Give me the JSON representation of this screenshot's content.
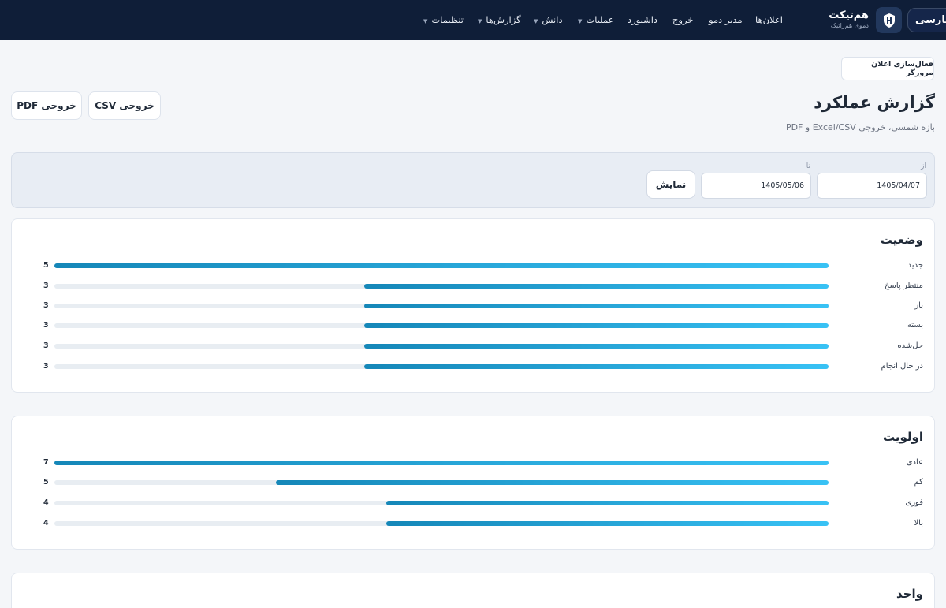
{
  "nav": {
    "lang": "فارسی",
    "brand_name": "هم‌تیکت",
    "brand_sub": "دموی هم‌راتیک",
    "items": [
      "اعلان‌ها",
      "مدیر دمو",
      "خروج",
      "داشبورد",
      "عملیات",
      "دانش",
      "گزارش‌ها",
      "تنظیمات"
    ]
  },
  "header": {
    "notify_button": "فعال‌سازی اعلان مرورگر",
    "title": "گزارش عملکرد",
    "subtitle": "بازه شمسی، خروجی Excel/CSV و PDF",
    "export_csv": "خروجی CSV",
    "export_pdf": "خروجی PDF"
  },
  "filter": {
    "from_label": "از",
    "to_label": "تا",
    "from_value": "1405/04/07",
    "to_value": "1405/05/06",
    "show_button": "نمایش"
  },
  "cards": [
    {
      "title": "وضعیت",
      "max": 5,
      "rows": [
        {
          "label": "جدید",
          "value": "5"
        },
        {
          "label": "منتظر پاسخ",
          "value": "3"
        },
        {
          "label": "باز",
          "value": "3"
        },
        {
          "label": "بسته",
          "value": "3"
        },
        {
          "label": "حل‌شده",
          "value": "3"
        },
        {
          "label": "در حال انجام",
          "value": "3"
        }
      ]
    },
    {
      "title": "اولویت",
      "max": 7,
      "rows": [
        {
          "label": "عادی",
          "value": "7"
        },
        {
          "label": "کم",
          "value": "5"
        },
        {
          "label": "فوری",
          "value": "4"
        },
        {
          "label": "بالا",
          "value": "4"
        }
      ]
    },
    {
      "title": "واحد",
      "max": 1,
      "rows": []
    }
  ],
  "colors": {
    "topbar": "#0f1e38",
    "bar_start": "#1587b8",
    "bar_end": "#38c2f5",
    "page_bg": "#f4f6f9"
  }
}
